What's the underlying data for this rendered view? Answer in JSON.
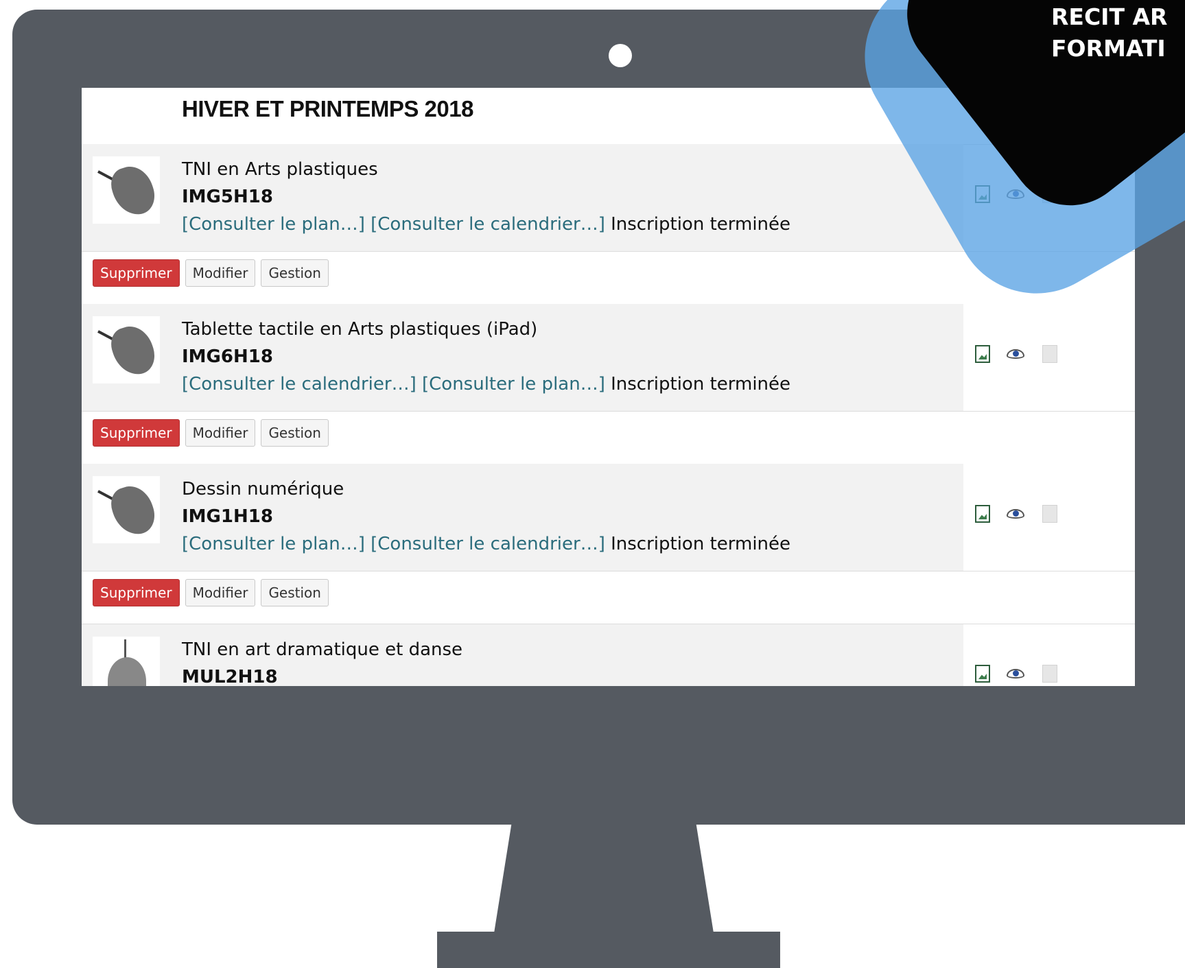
{
  "section": {
    "title": "HIVER ET PRINTEMPS 2018"
  },
  "courses": [
    {
      "title": "TNI en Arts plastiques",
      "code": "IMG5H18",
      "link1": "[Consulter le plan…]",
      "link2": "[Consulter le calendrier…]",
      "status": "Inscription terminée"
    },
    {
      "title": "Tablette tactile en Arts plastiques (iPad)",
      "code": "IMG6H18",
      "link1": "[Consulter le calendrier…]",
      "link2": "[Consulter le plan…]",
      "status": "Inscription terminée"
    },
    {
      "title": "Dessin numérique",
      "code": "IMG1H18",
      "link1": "[Consulter le plan…]",
      "link2": "[Consulter le calendrier…]",
      "status": "Inscription terminée"
    },
    {
      "title": "TNI en art dramatique et danse",
      "code": "MUL2H18"
    }
  ],
  "actions": {
    "delete_label": "Supprimer",
    "edit_label": "Modifier",
    "manage_label": "Gestion"
  },
  "corner_banner": {
    "line1": "RECIT AR",
    "line2": "FORMATI"
  },
  "icons": {
    "header": [
      "sum-icon",
      "ban-icon"
    ],
    "row": [
      "image-file-icon",
      "eye-icon",
      "document-icon"
    ]
  },
  "colors": {
    "monitor": "#555a61",
    "delete_button": "#d0393a",
    "link": "#2a6c7c",
    "overlay_blue": "#5aa3e4",
    "overlay_black": "#050505"
  }
}
